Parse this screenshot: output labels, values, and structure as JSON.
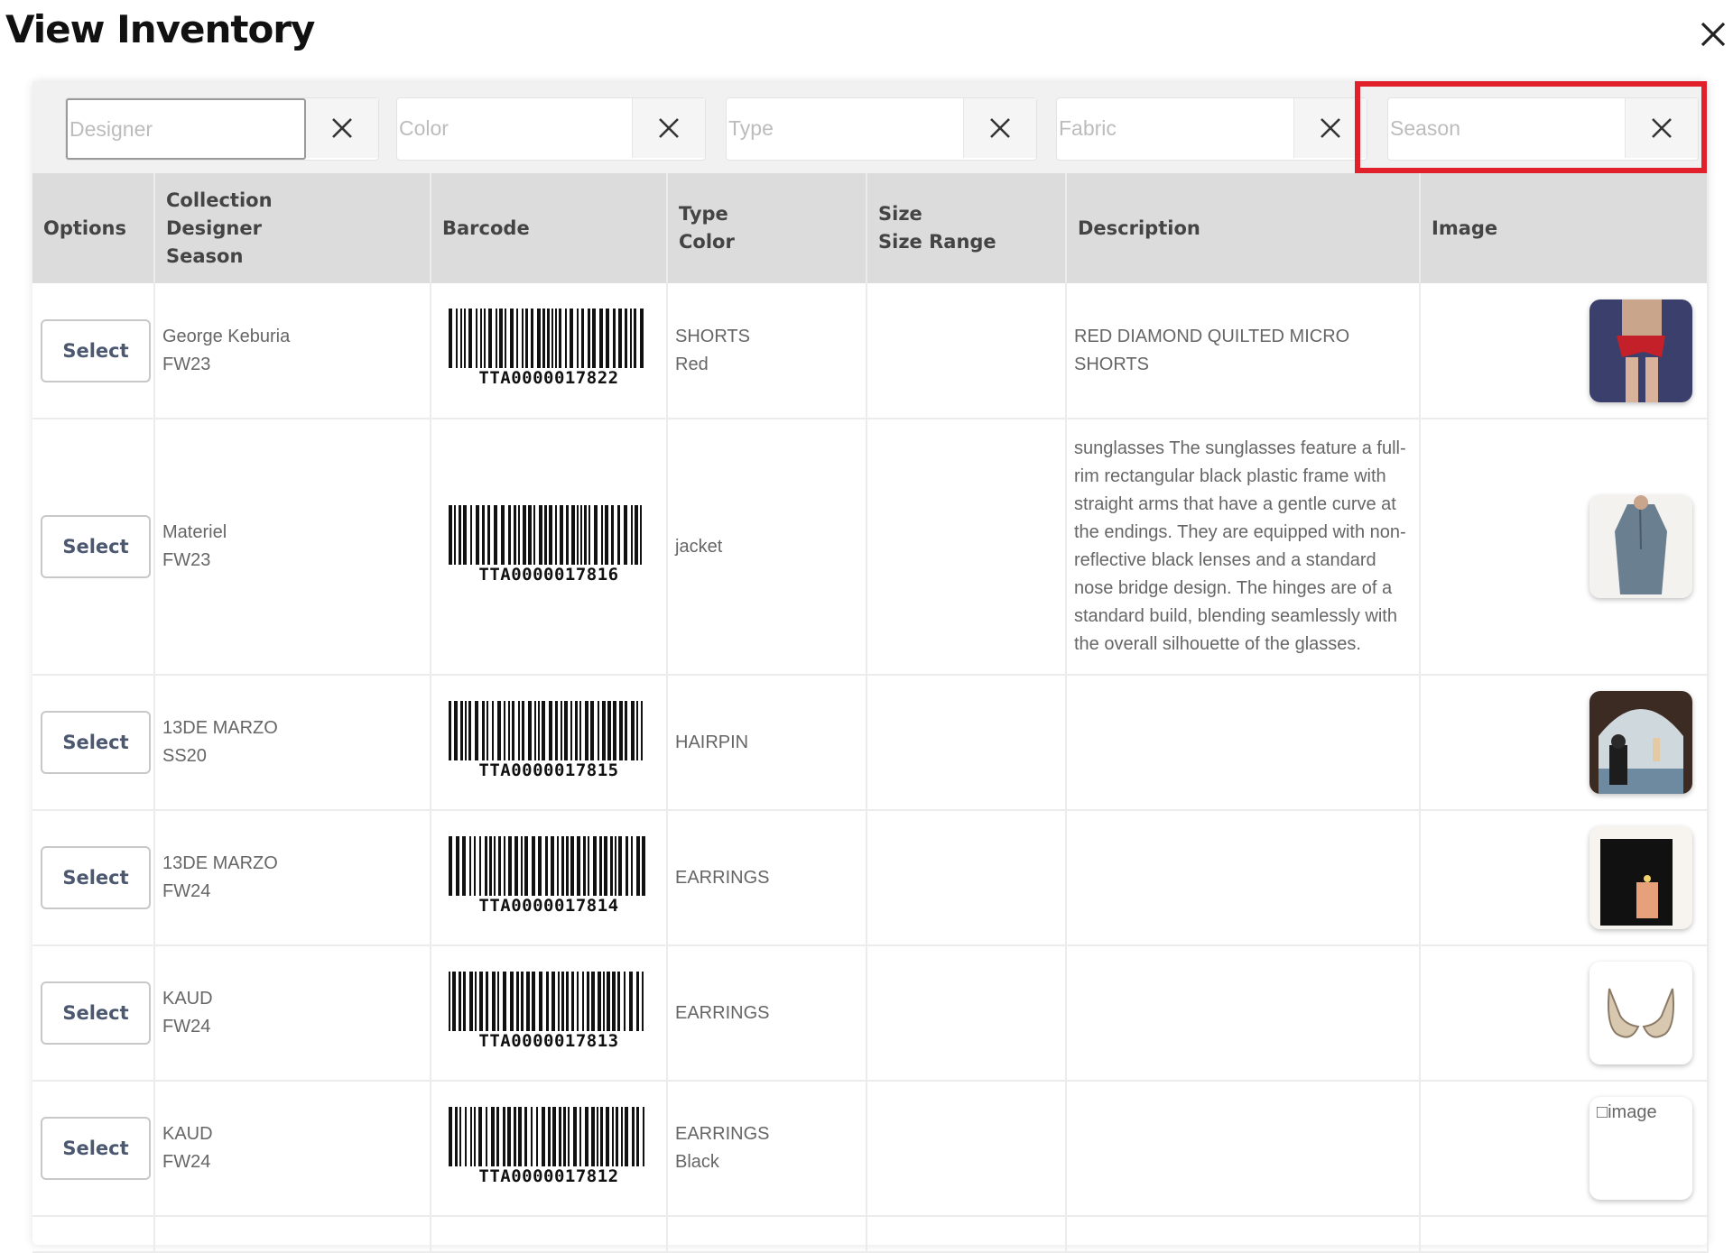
{
  "header": {
    "title": "View Inventory"
  },
  "filters": [
    {
      "placeholder": "Designer",
      "value": ""
    },
    {
      "placeholder": "Color",
      "value": ""
    },
    {
      "placeholder": "Type",
      "value": ""
    },
    {
      "placeholder": "Fabric",
      "value": ""
    },
    {
      "placeholder": "Season",
      "value": ""
    }
  ],
  "table": {
    "headers": {
      "options": "Options",
      "collection": [
        "Collection",
        "Designer",
        "Season"
      ],
      "barcode": "Barcode",
      "type_color": [
        "Type",
        "Color"
      ],
      "size": [
        "Size",
        "Size Range"
      ],
      "description": "Description",
      "image": "Image"
    },
    "select_label": "Select",
    "rows": [
      {
        "designer": "George Keburia",
        "season": "FW23",
        "barcode": "TTA0000017822",
        "type": "SHORTS",
        "color": "Red",
        "description": "RED DIAMOND QUILTED MICRO SHORTS",
        "image_name": "shorts-photo-icon"
      },
      {
        "designer": "Materiel",
        "season": "FW23",
        "barcode": "TTA0000017816",
        "type": "jacket",
        "color": "",
        "description": "sunglasses The sunglasses feature a full-rim rectangular black plastic frame with straight arms that have a gentle curve at the endings. They are equipped with non-reflective black lenses and a standard nose bridge design. The hinges are of a standard build, blending seamlessly with the overall silhouette of the glasses.",
        "image_name": "jacket-photo-icon"
      },
      {
        "designer": "13DE MARZO",
        "season": "SS20",
        "barcode": "TTA0000017815",
        "type": "HAIRPIN",
        "color": "",
        "description": "",
        "image_name": "hairpin-photo-icon"
      },
      {
        "designer": "13DE MARZO",
        "season": "FW24",
        "barcode": "TTA0000017814",
        "type": "EARRINGS",
        "color": "",
        "description": "",
        "image_name": "earrings-photo-icon"
      },
      {
        "designer": "KAUD",
        "season": "FW24",
        "barcode": "TTA0000017813",
        "type": "EARRINGS",
        "color": "",
        "description": "",
        "image_name": "earrings-photo-icon"
      },
      {
        "designer": "KAUD",
        "season": "FW24",
        "barcode": "TTA0000017812",
        "type": "EARRINGS",
        "color": "Black",
        "description": "",
        "image_alt": "image",
        "image_name": "broken-image-icon"
      }
    ]
  },
  "colors": {
    "highlight": "#e0202b",
    "header_bg": "#dcdcdc",
    "filter_bg": "#f1f1f1"
  }
}
